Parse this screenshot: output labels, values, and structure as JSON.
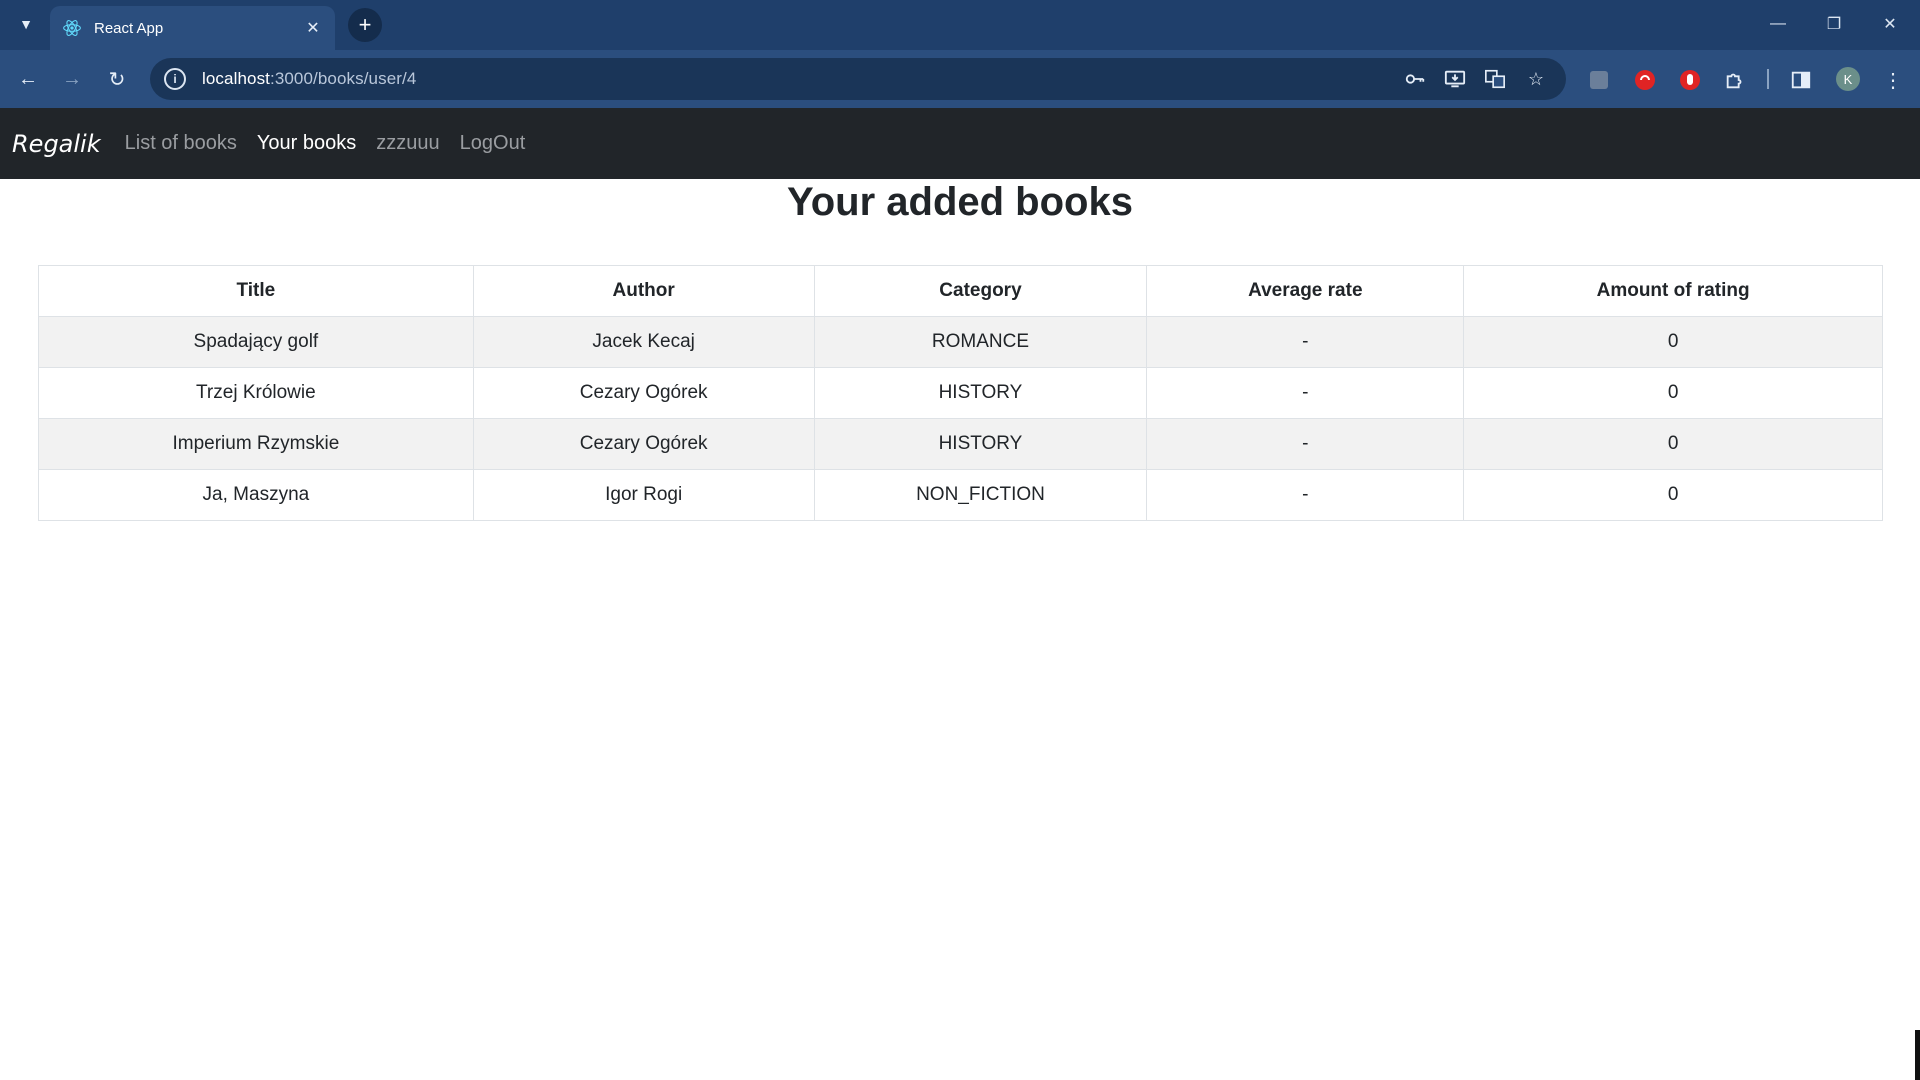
{
  "browser": {
    "tab_title": "React App",
    "url_host": "localhost",
    "url_rest": ":3000/books/user/4",
    "avatar_letter": "K"
  },
  "navbar": {
    "brand": "Regalik",
    "links": [
      {
        "label": "List of books",
        "active": false
      },
      {
        "label": "Your books",
        "active": true
      },
      {
        "label": "zzzuuu",
        "active": false
      },
      {
        "label": "LogOut",
        "active": false
      }
    ]
  },
  "page": {
    "title": "Your added books"
  },
  "table": {
    "headers": [
      "Title",
      "Author",
      "Category",
      "Average rate",
      "Amount of rating"
    ],
    "rows": [
      [
        "Spadający golf",
        "Jacek Kecaj",
        "ROMANCE",
        "-",
        "0"
      ],
      [
        "Trzej Królowie",
        "Cezary Ogórek",
        "HISTORY",
        "-",
        "0"
      ],
      [
        "Imperium Rzymskie",
        "Cezary Ogórek",
        "HISTORY",
        "-",
        "0"
      ],
      [
        "Ja, Maszyna",
        "Igor Rogi",
        "NON_FICTION",
        "-",
        "0"
      ]
    ]
  },
  "colors": {
    "tabstrip": "#1f3f6b",
    "toolbar": "#2b4e7e",
    "navbar": "#212529",
    "striped_row": "#f2f2f2"
  }
}
